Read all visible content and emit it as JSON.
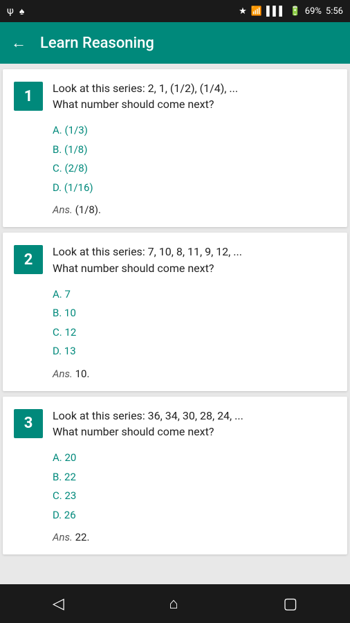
{
  "statusBar": {
    "leftIcons": [
      "usb",
      "android"
    ],
    "rightIcons": [
      "star",
      "wifi",
      "signal",
      "battery"
    ],
    "batteryPercent": "69%",
    "time": "5:56"
  },
  "appBar": {
    "title": "Learn Reasoning",
    "backLabel": "←"
  },
  "questions": [
    {
      "number": "1",
      "text": "Look at this series: 2, 1, (1/2), (1/4), ...\nWhat number should come next?",
      "options": [
        "A. (1/3)",
        "B. (1/8)",
        "C. (2/8)",
        "D. (1/16)"
      ],
      "ansLabel": "Ans.",
      "ansValue": " (1/8)."
    },
    {
      "number": "2",
      "text": "Look at this series: 7, 10, 8, 11, 9, 12, ...\nWhat number should come next?",
      "options": [
        "A. 7",
        "B. 10",
        "C. 12",
        "D. 13"
      ],
      "ansLabel": "Ans.",
      "ansValue": " 10."
    },
    {
      "number": "3",
      "text": "Look at this series: 36, 34, 30, 28, 24, ...\nWhat number should come next?",
      "options": [
        "A. 20",
        "B. 22",
        "C. 23",
        "D. 26"
      ],
      "ansLabel": "Ans.",
      "ansValue": " 22."
    }
  ],
  "navBar": {
    "backIcon": "◁",
    "homeIcon": "⌂",
    "squareIcon": "▢"
  }
}
